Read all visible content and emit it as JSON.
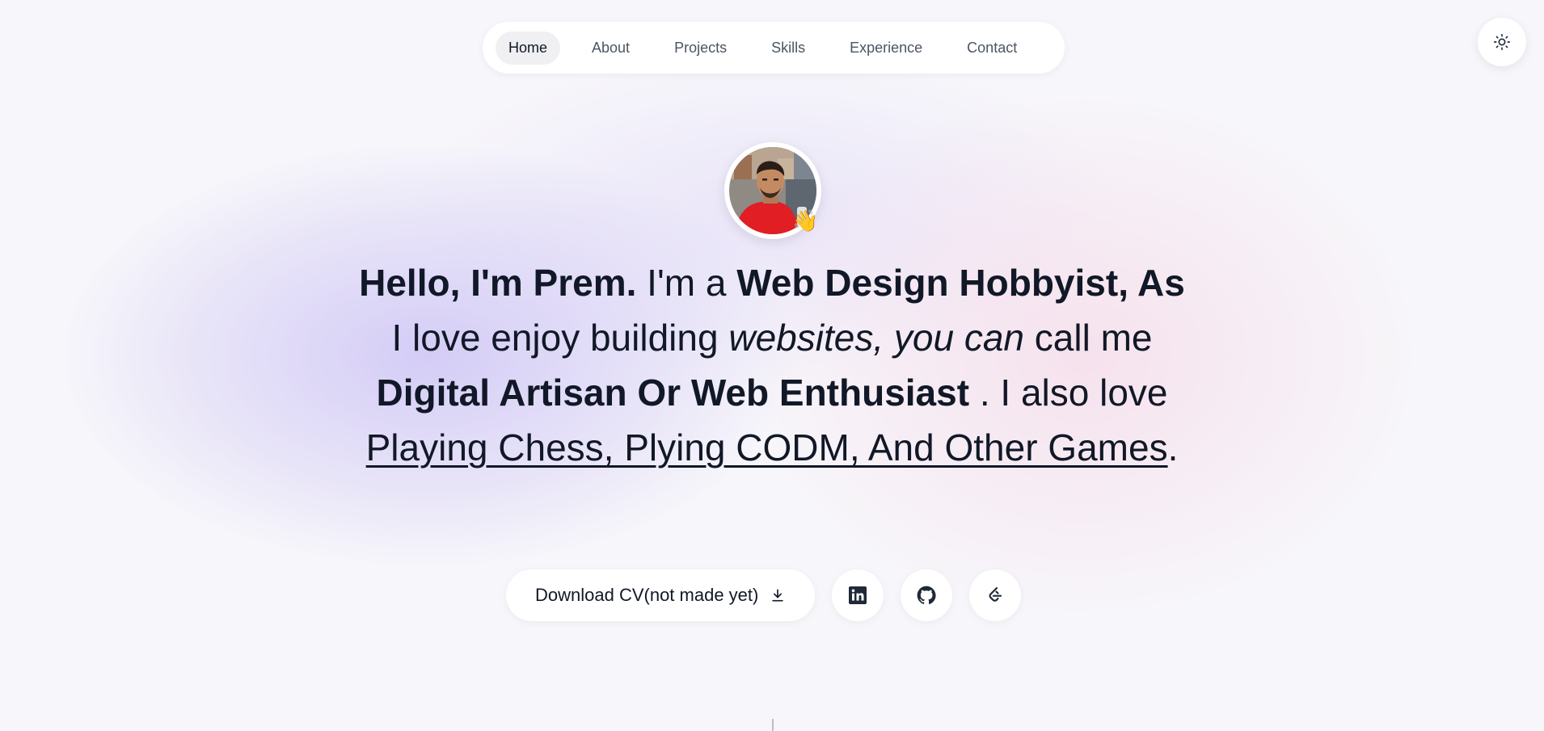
{
  "nav": {
    "items": [
      {
        "label": "Home",
        "active": true
      },
      {
        "label": "About"
      },
      {
        "label": "Projects"
      },
      {
        "label": "Skills"
      },
      {
        "label": "Experience"
      },
      {
        "label": "Contact"
      }
    ]
  },
  "theme_toggle": {
    "icon": "sun-icon"
  },
  "avatar": {
    "emoji": "👋"
  },
  "headline": {
    "greeting": "Hello, I'm Prem.",
    "t1": " I'm a ",
    "role": "Web Design Hobbyist, As",
    "t2": " I love enjoy building ",
    "italic": "websites, you can",
    "t3": " call me ",
    "title": "Digital Artisan Or Web Enthusiast",
    "t4": " . I also love ",
    "hobbies": "Playing Chess, Plying CODM, And Other Games",
    "t5": "."
  },
  "actions": {
    "cv_label": "Download CV(not made yet)",
    "cv_icon": "download-icon",
    "social": [
      {
        "icon": "linkedin-icon"
      },
      {
        "icon": "github-icon"
      },
      {
        "icon": "leetcode-icon"
      }
    ]
  },
  "colors": {
    "text": "#111827",
    "muted": "#4b5563",
    "surface": "#ffffff"
  }
}
